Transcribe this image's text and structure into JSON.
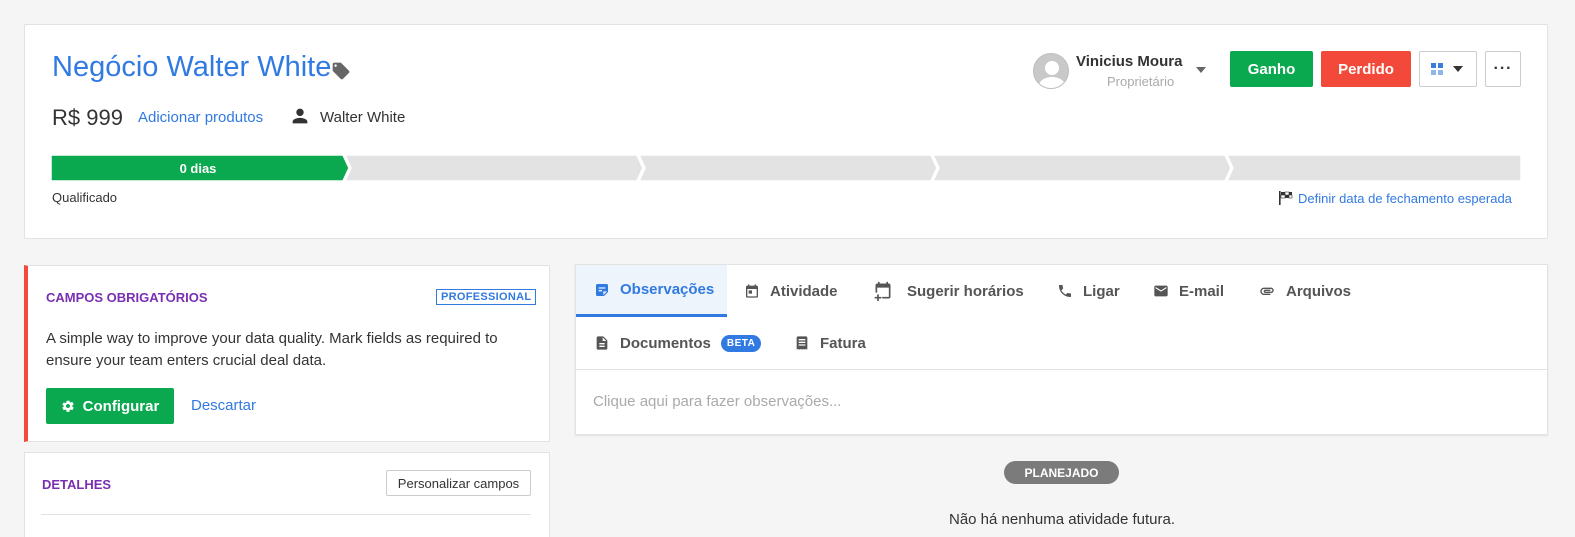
{
  "deal": {
    "title": "Negócio Walter White",
    "value": "R$ 999",
    "add_products": "Adicionar produtos",
    "person": "Walter White"
  },
  "owner": {
    "name": "Vinicius Moura",
    "role": "Proprietário"
  },
  "actions": {
    "won": "Ganho",
    "lost": "Perdido",
    "more": "···"
  },
  "pipeline": {
    "current_stage_label": "0 dias",
    "stage_count": 5,
    "current_stage_index": 0,
    "stage_name": "Qualificado",
    "close_date_link": "Definir data de fechamento esperada",
    "colors": {
      "active": "#0aa84f",
      "inactive": "#e3e3e3"
    }
  },
  "required_fields": {
    "title": "CAMPOS OBRIGATÓRIOS",
    "badge": "PROFESSIONAL",
    "text": "A simple way to improve your data quality. Mark fields as required to ensure your team enters crucial deal data.",
    "configure": "Configurar",
    "dismiss": "Descartar"
  },
  "details": {
    "title": "DETALHES",
    "customize": "Personalizar campos"
  },
  "activity": {
    "tabs": [
      {
        "label": "Observações",
        "icon": "note-icon",
        "active": true
      },
      {
        "label": "Atividade",
        "icon": "calendar-icon"
      },
      {
        "label": "Sugerir horários",
        "icon": "calendar-add-icon"
      },
      {
        "label": "Ligar",
        "icon": "phone-icon"
      },
      {
        "label": "E-mail",
        "icon": "mail-icon"
      },
      {
        "label": "Arquivos",
        "icon": "paperclip-icon"
      },
      {
        "label": "Documentos",
        "icon": "document-icon",
        "badge": "BETA"
      },
      {
        "label": "Fatura",
        "icon": "invoice-icon"
      }
    ],
    "notes_placeholder": "Clique aqui para fazer observações...",
    "planned": "PLANEJADO",
    "no_activity": "Não há nenhuma atividade futura."
  }
}
